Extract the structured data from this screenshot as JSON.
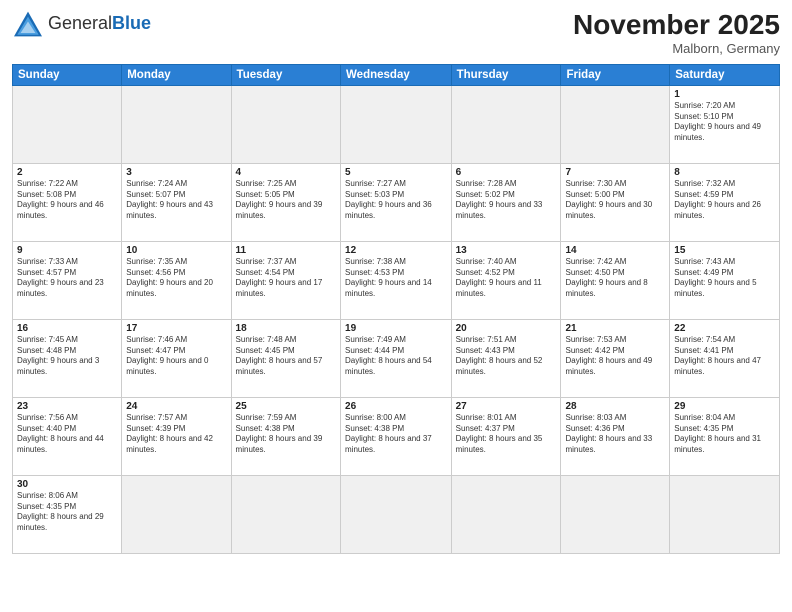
{
  "header": {
    "logo_general": "General",
    "logo_blue": "Blue",
    "month_title": "November 2025",
    "location": "Malborn, Germany"
  },
  "weekdays": [
    "Sunday",
    "Monday",
    "Tuesday",
    "Wednesday",
    "Thursday",
    "Friday",
    "Saturday"
  ],
  "weeks": [
    [
      {
        "day": "",
        "info": ""
      },
      {
        "day": "",
        "info": ""
      },
      {
        "day": "",
        "info": ""
      },
      {
        "day": "",
        "info": ""
      },
      {
        "day": "",
        "info": ""
      },
      {
        "day": "",
        "info": ""
      },
      {
        "day": "1",
        "info": "Sunrise: 7:20 AM\nSunset: 5:10 PM\nDaylight: 9 hours and 49 minutes."
      }
    ],
    [
      {
        "day": "2",
        "info": "Sunrise: 7:22 AM\nSunset: 5:08 PM\nDaylight: 9 hours and 46 minutes."
      },
      {
        "day": "3",
        "info": "Sunrise: 7:24 AM\nSunset: 5:07 PM\nDaylight: 9 hours and 43 minutes."
      },
      {
        "day": "4",
        "info": "Sunrise: 7:25 AM\nSunset: 5:05 PM\nDaylight: 9 hours and 39 minutes."
      },
      {
        "day": "5",
        "info": "Sunrise: 7:27 AM\nSunset: 5:03 PM\nDaylight: 9 hours and 36 minutes."
      },
      {
        "day": "6",
        "info": "Sunrise: 7:28 AM\nSunset: 5:02 PM\nDaylight: 9 hours and 33 minutes."
      },
      {
        "day": "7",
        "info": "Sunrise: 7:30 AM\nSunset: 5:00 PM\nDaylight: 9 hours and 30 minutes."
      },
      {
        "day": "8",
        "info": "Sunrise: 7:32 AM\nSunset: 4:59 PM\nDaylight: 9 hours and 26 minutes."
      }
    ],
    [
      {
        "day": "9",
        "info": "Sunrise: 7:33 AM\nSunset: 4:57 PM\nDaylight: 9 hours and 23 minutes."
      },
      {
        "day": "10",
        "info": "Sunrise: 7:35 AM\nSunset: 4:56 PM\nDaylight: 9 hours and 20 minutes."
      },
      {
        "day": "11",
        "info": "Sunrise: 7:37 AM\nSunset: 4:54 PM\nDaylight: 9 hours and 17 minutes."
      },
      {
        "day": "12",
        "info": "Sunrise: 7:38 AM\nSunset: 4:53 PM\nDaylight: 9 hours and 14 minutes."
      },
      {
        "day": "13",
        "info": "Sunrise: 7:40 AM\nSunset: 4:52 PM\nDaylight: 9 hours and 11 minutes."
      },
      {
        "day": "14",
        "info": "Sunrise: 7:42 AM\nSunset: 4:50 PM\nDaylight: 9 hours and 8 minutes."
      },
      {
        "day": "15",
        "info": "Sunrise: 7:43 AM\nSunset: 4:49 PM\nDaylight: 9 hours and 5 minutes."
      }
    ],
    [
      {
        "day": "16",
        "info": "Sunrise: 7:45 AM\nSunset: 4:48 PM\nDaylight: 9 hours and 3 minutes."
      },
      {
        "day": "17",
        "info": "Sunrise: 7:46 AM\nSunset: 4:47 PM\nDaylight: 9 hours and 0 minutes."
      },
      {
        "day": "18",
        "info": "Sunrise: 7:48 AM\nSunset: 4:45 PM\nDaylight: 8 hours and 57 minutes."
      },
      {
        "day": "19",
        "info": "Sunrise: 7:49 AM\nSunset: 4:44 PM\nDaylight: 8 hours and 54 minutes."
      },
      {
        "day": "20",
        "info": "Sunrise: 7:51 AM\nSunset: 4:43 PM\nDaylight: 8 hours and 52 minutes."
      },
      {
        "day": "21",
        "info": "Sunrise: 7:53 AM\nSunset: 4:42 PM\nDaylight: 8 hours and 49 minutes."
      },
      {
        "day": "22",
        "info": "Sunrise: 7:54 AM\nSunset: 4:41 PM\nDaylight: 8 hours and 47 minutes."
      }
    ],
    [
      {
        "day": "23",
        "info": "Sunrise: 7:56 AM\nSunset: 4:40 PM\nDaylight: 8 hours and 44 minutes."
      },
      {
        "day": "24",
        "info": "Sunrise: 7:57 AM\nSunset: 4:39 PM\nDaylight: 8 hours and 42 minutes."
      },
      {
        "day": "25",
        "info": "Sunrise: 7:59 AM\nSunset: 4:38 PM\nDaylight: 8 hours and 39 minutes."
      },
      {
        "day": "26",
        "info": "Sunrise: 8:00 AM\nSunset: 4:38 PM\nDaylight: 8 hours and 37 minutes."
      },
      {
        "day": "27",
        "info": "Sunrise: 8:01 AM\nSunset: 4:37 PM\nDaylight: 8 hours and 35 minutes."
      },
      {
        "day": "28",
        "info": "Sunrise: 8:03 AM\nSunset: 4:36 PM\nDaylight: 8 hours and 33 minutes."
      },
      {
        "day": "29",
        "info": "Sunrise: 8:04 AM\nSunset: 4:35 PM\nDaylight: 8 hours and 31 minutes."
      }
    ],
    [
      {
        "day": "30",
        "info": "Sunrise: 8:06 AM\nSunset: 4:35 PM\nDaylight: 8 hours and 29 minutes."
      },
      {
        "day": "",
        "info": ""
      },
      {
        "day": "",
        "info": ""
      },
      {
        "day": "",
        "info": ""
      },
      {
        "day": "",
        "info": ""
      },
      {
        "day": "",
        "info": ""
      },
      {
        "day": "",
        "info": ""
      }
    ]
  ]
}
